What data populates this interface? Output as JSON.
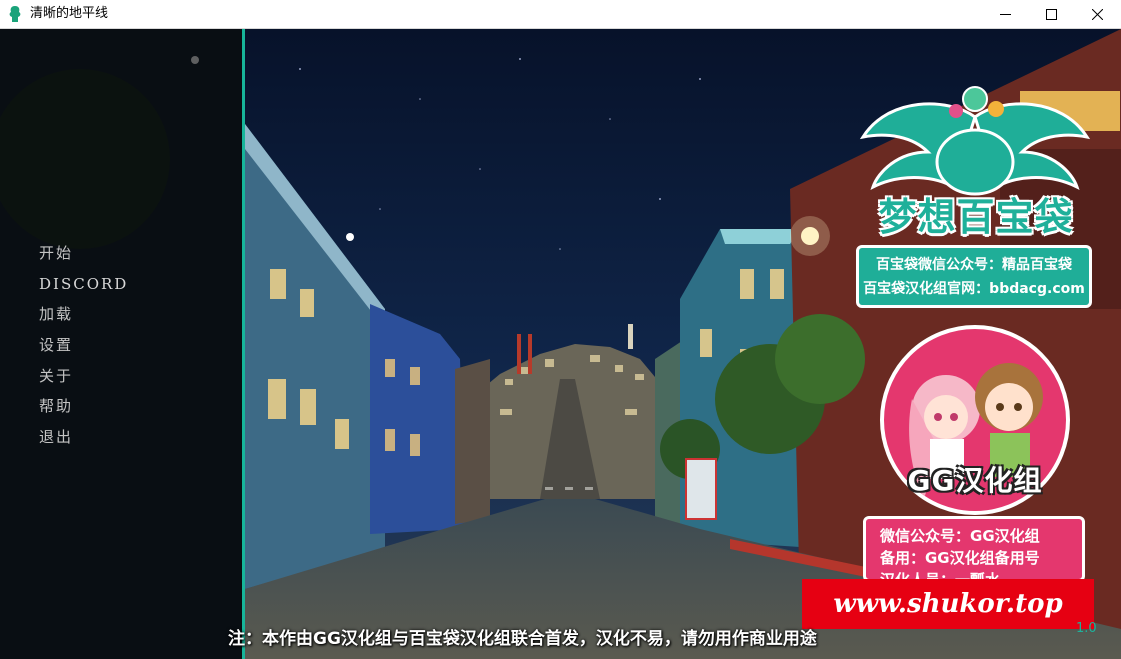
{
  "window": {
    "title": "清晰的地平线",
    "controls": [
      "minimize",
      "maximize",
      "close"
    ]
  },
  "menu": {
    "items": [
      {
        "label": "开始"
      },
      {
        "label": "DISCORD"
      },
      {
        "label": "加载"
      },
      {
        "label": "设置"
      },
      {
        "label": "关于"
      },
      {
        "label": "帮助"
      },
      {
        "label": "退出"
      }
    ]
  },
  "promo": {
    "logo_text": "梦想百宝袋",
    "info_line1": "百宝袋微信公众号：精品百宝袋",
    "info_line2": "百宝袋汉化组官网：bbdacg.com",
    "gg_label": "GG汉化组",
    "pink_line1": "微信公众号：GG汉化组",
    "pink_line2": "备用：GG汉化组备用号",
    "pink_line3": "汉化人员：一瓢水",
    "site": "www.shukor.top"
  },
  "notice": "注：本作由GG汉化组与百宝袋汉化组联合首发，汉化不易，请勿用作商业用途",
  "version": "1.0",
  "colors": {
    "accent": "#17b59a",
    "promo_teal": "#1fae98",
    "promo_pink": "#e4376e",
    "site_red": "#e60012"
  }
}
